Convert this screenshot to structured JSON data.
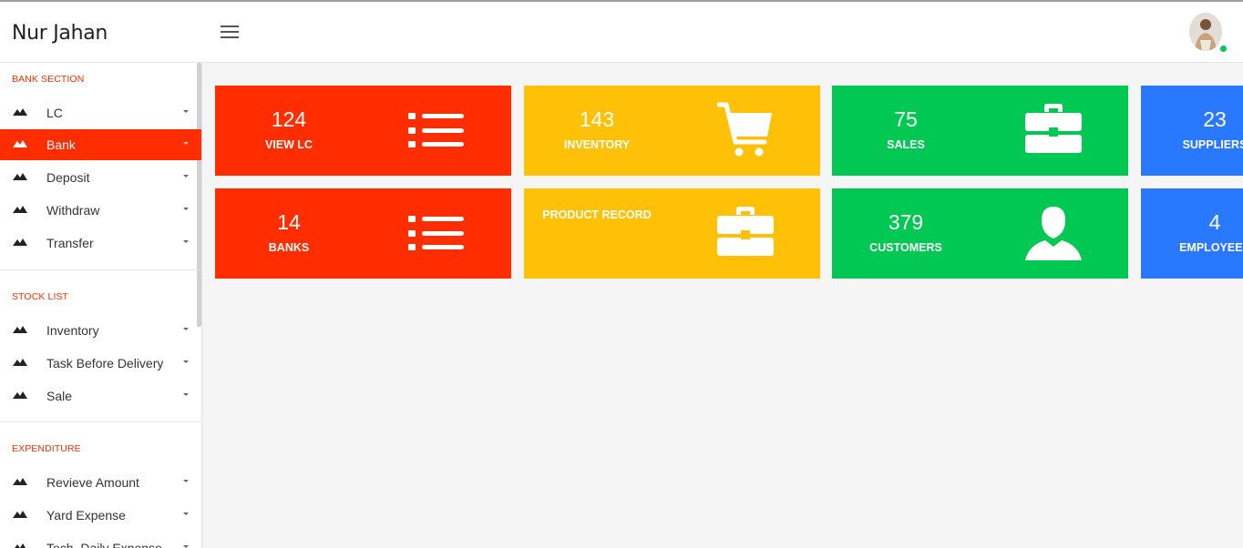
{
  "header": {
    "brand": "Nur Jahan",
    "menu_icon": "hamburger-icon",
    "avatar_icon": "user-avatar",
    "status_color": "#00c853"
  },
  "colors": {
    "accent": "#ff2d00",
    "red": "#ff2d00",
    "yellow": "#ffc107",
    "green": "#00c853",
    "blue": "#2979ff"
  },
  "sidebar": {
    "sections": [
      {
        "title": "BANK SECTION",
        "items": [
          {
            "label": "LC",
            "active": false
          },
          {
            "label": "Bank",
            "active": true
          },
          {
            "label": "Deposit",
            "active": false
          },
          {
            "label": "Withdraw",
            "active": false
          },
          {
            "label": "Transfer",
            "active": false
          }
        ]
      },
      {
        "title": "STOCK LIST",
        "items": [
          {
            "label": "Inventory",
            "active": false
          },
          {
            "label": "Task Before Delivery",
            "active": false
          },
          {
            "label": "Sale",
            "active": false
          }
        ]
      },
      {
        "title": "EXPENDITURE",
        "items": [
          {
            "label": "Revieve Amount",
            "active": false
          },
          {
            "label": "Yard Expense",
            "active": false
          },
          {
            "label": "Tech. Daily Expense",
            "active": false
          }
        ]
      }
    ]
  },
  "cards": [
    {
      "value": "124",
      "label": "VIEW LC",
      "color": "#ff2d00",
      "icon": "list-icon"
    },
    {
      "value": "143",
      "label": "INVENTORY",
      "color": "#ffc107",
      "icon": "cart-icon"
    },
    {
      "value": "75",
      "label": "SALES",
      "color": "#00c853",
      "icon": "briefcase-icon"
    },
    {
      "value": "23",
      "label": "SUPPLIERS",
      "color": "#2979ff",
      "icon": "truck-icon"
    },
    {
      "value": "14",
      "label": "BANKS",
      "color": "#ff2d00",
      "icon": "list-icon"
    },
    {
      "value": "",
      "label": "PRODUCT RECORD",
      "color": "#ffc107",
      "icon": "briefcase-icon"
    },
    {
      "value": "379",
      "label": "CUSTOMERS",
      "color": "#00c853",
      "icon": "user-icon"
    },
    {
      "value": "4",
      "label": "EMPLOYEES",
      "color": "#2979ff",
      "icon": "users-icon"
    }
  ]
}
